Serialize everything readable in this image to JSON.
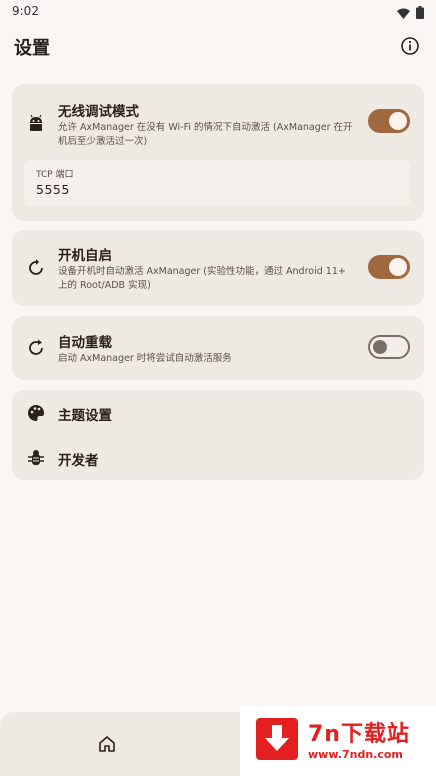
{
  "status_bar": {
    "time": "9:02"
  },
  "app_bar": {
    "title": "设置"
  },
  "wireless_debug": {
    "title": "无线调试模式",
    "description": "允许 AxManager 在没有 Wi-Fi 的情况下自动激活 (AxManager 在开机后至少激活过一次)",
    "enabled": true,
    "port_label": "TCP 端口",
    "port_value": "5555"
  },
  "boot_start": {
    "title": "开机自启",
    "description": "设备开机时自动激活 AxManager (实验性功能，通过 Android 11+ 上的 Root/ADB 实现)",
    "enabled": true
  },
  "auto_reload": {
    "title": "自动重载",
    "description": "启动 AxManager 时将尝试自动激活服务",
    "enabled": false
  },
  "menu": {
    "theme_label": "主题设置",
    "developer_label": "开发者"
  },
  "colors": {
    "accent": "#A0683F",
    "card": "#EFE9E4",
    "background": "#FAF6F3",
    "watermark": "#E41F1F"
  },
  "watermark": {
    "title": "7n下载站",
    "url": "www.7ndn.com"
  }
}
